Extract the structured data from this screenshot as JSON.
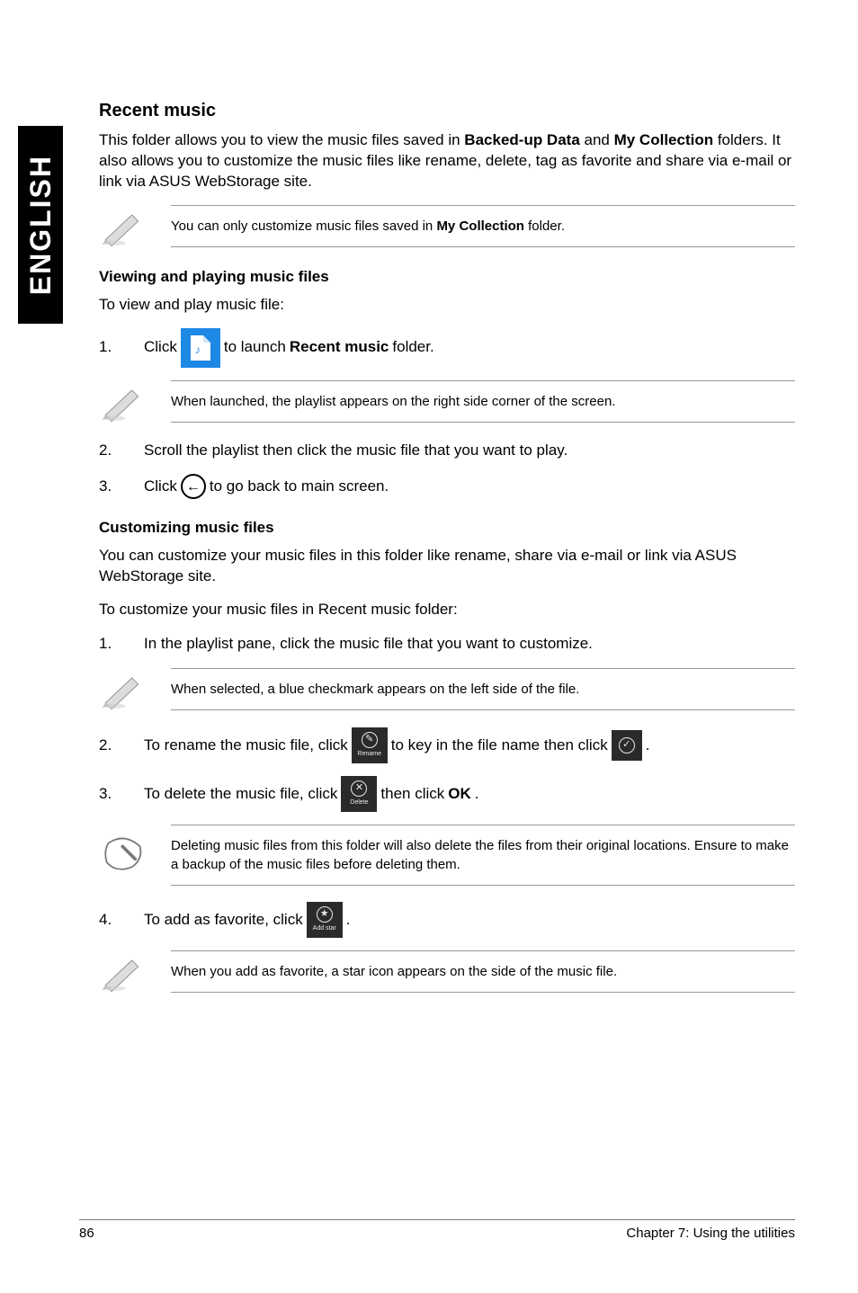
{
  "sideTab": "ENGLISH",
  "recentMusic": {
    "title": "Recent music",
    "intro_pre": "This folder allows you to view the music files saved in ",
    "intro_bold1": "Backed-up Data",
    "intro_mid1": " and ",
    "intro_bold2": "My Collection",
    "intro_post": " folders. It also allows you to customize the music files like rename, delete, tag as favorite and share via e-mail or link via ASUS WebStorage site.",
    "note1_pre": "You can only customize music files saved in ",
    "note1_bold": "My Collection",
    "note1_post": " folder."
  },
  "viewing": {
    "heading": "Viewing and playing music files",
    "lead": "To view and play music file:",
    "step1_pre": "Click ",
    "step1_mid": " to launch ",
    "step1_bold": "Recent music",
    "step1_post": " folder.",
    "note": "When launched, the playlist appears on the right side corner of the screen.",
    "step2": "Scroll the playlist then click the music file that you want to play.",
    "step3_pre": "Click ",
    "step3_post": " to go back to main screen."
  },
  "customizing": {
    "heading": "Customizing music files",
    "lead1": "You can customize your music files in this folder like rename, share via e-mail or link via ASUS WebStorage site.",
    "lead2": "To customize your music files in Recent music folder:",
    "step1": "In the playlist pane, click the music file that you want to customize.",
    "note_selected": "When selected, a blue checkmark appears on the left side of the file.",
    "step2_pre": "To rename the music file, click ",
    "step2_mid": " to key in the file name then click ",
    "step2_post": ".",
    "step3_pre": "To delete the music file, click ",
    "step3_mid": " then click ",
    "step3_bold": "OK",
    "step3_post": ".",
    "note_delete": "Deleting music files from this folder will also delete the files from their original locations. Ensure to make a backup of the music files before deleting them.",
    "step4_pre": "To add as favorite, click ",
    "step4_post": ".",
    "note_favorite": "When you add as favorite, a star icon appears on the side of the music file."
  },
  "buttons": {
    "rename": "Rename",
    "delete": "Delete",
    "addstar": "Add star"
  },
  "footer": {
    "page": "86",
    "chapter": "Chapter 7: Using the utilities"
  }
}
